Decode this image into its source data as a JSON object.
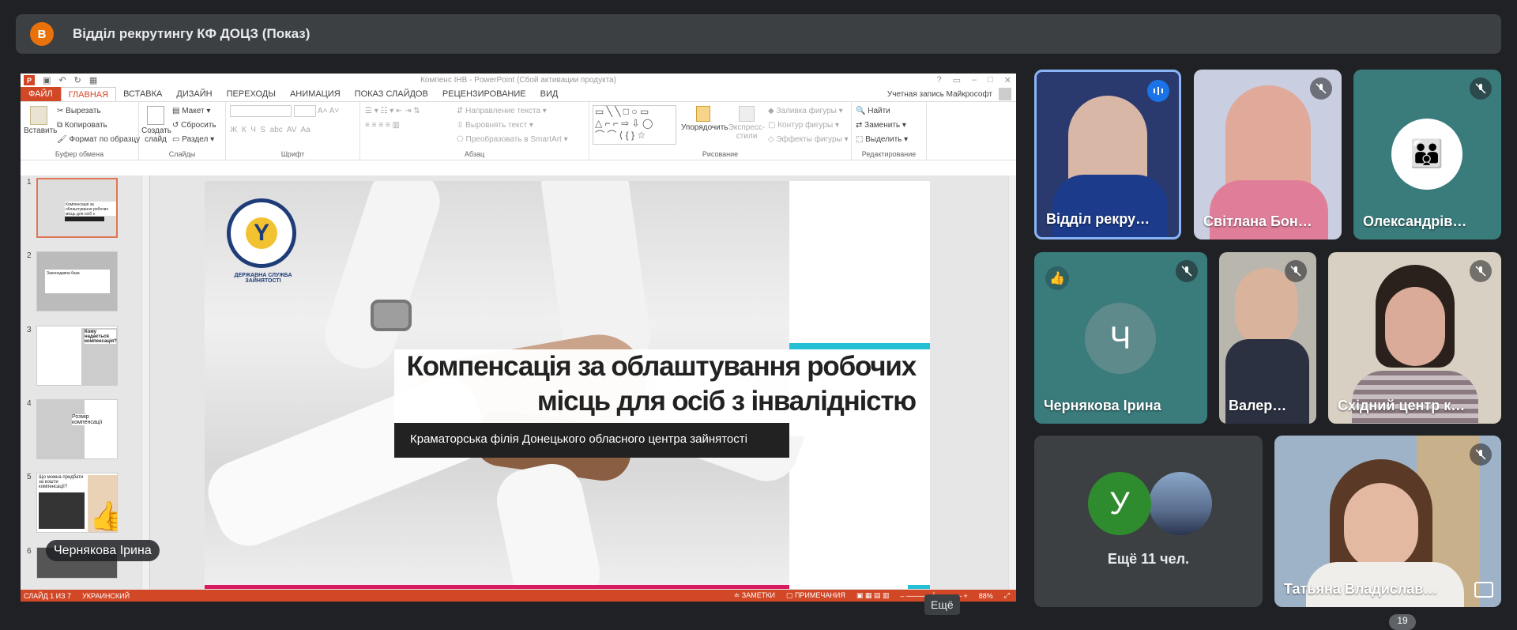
{
  "meeting": {
    "avatar_letter": "В",
    "title": "Відділ рекрутингу КФ ДОЦЗ (Показ)"
  },
  "ppt": {
    "window_title": "Компенс ІНВ - PowerPoint (Сбой активации продукта)",
    "app_badge": "P",
    "tabs": [
      "ФАЙЛ",
      "ГЛАВНАЯ",
      "ВСТАВКА",
      "ДИЗАЙН",
      "ПЕРЕХОДЫ",
      "АНИМАЦИЯ",
      "ПОКАЗ СЛАЙДОВ",
      "РЕЦЕНЗИРОВАНИЕ",
      "ВИД"
    ],
    "active_tab": "ГЛАВНАЯ",
    "account": "Учетная запись Майкрософт",
    "ribbon": {
      "clipboard": {
        "paste": "Вставить",
        "cut": "Вырезать",
        "copy": "Копировать",
        "format": "Формат по образцу",
        "label": "Буфер обмена"
      },
      "slides": {
        "new_slide": "Создать слайд",
        "layout": "Макет",
        "reset": "Сбросить",
        "section": "Раздел",
        "label": "Слайды"
      },
      "font": {
        "label": "Шрифт",
        "styles": [
          "Ж",
          "К",
          "Ч",
          "S",
          "abc",
          "AV",
          "Aa"
        ]
      },
      "paragraph": {
        "direction": "Направление текста",
        "align": "Выровнять текст",
        "smartart": "Преобразовать в SmartArt",
        "label": "Абзац"
      },
      "drawing": {
        "arrange": "Упорядочить",
        "quick_styles": "Экспресс-стили",
        "fill": "Заливка фигуры",
        "outline": "Контур фигуры",
        "effects": "Эффекты фигуры",
        "label": "Рисование"
      },
      "editing": {
        "find": "Найти",
        "replace": "Заменить",
        "select": "Выделить",
        "label": "Редактирование"
      }
    },
    "thumbnails": [
      {
        "num": "1",
        "text": "Компенсація за облаштування робочих місць для осіб з інвалідністю"
      },
      {
        "num": "2",
        "text": "Законодавча база"
      },
      {
        "num": "3",
        "text": "Кому надається компенсація?"
      },
      {
        "num": "4",
        "text": "Розмір компенсації"
      },
      {
        "num": "5",
        "text": "Що можна придбати за кошти компенсації?"
      },
      {
        "num": "6",
        "text": ""
      }
    ],
    "slide": {
      "title_line1": "Компенсація за облаштування робочих",
      "title_line2": "місць для осіб з інвалідністю",
      "subtitle": "Краматорська філія Донецького обласного центра зайнятості",
      "logo_text": "ДЕРЖАВНА СЛУЖБА ЗАЙНЯТОСТІ",
      "logo_symbol": "Y"
    },
    "status": {
      "slide": "СЛАЙД 1 ИЗ 7",
      "language": "УКРАИНСКИЙ",
      "notes": "ЗАМЕТКИ",
      "comments": "ПРИМЕЧАНИЯ",
      "zoom": "88%"
    }
  },
  "presenter_chip": "Чернякова Ірина",
  "participants": [
    {
      "name": "Відділ рекру…",
      "state": "speaking"
    },
    {
      "name": "Світлана Бон…",
      "state": "muted"
    },
    {
      "name": "Олександрів…",
      "state": "muted"
    },
    {
      "name": "Чернякова Ірина",
      "state": "muted",
      "initial": "Ч",
      "reaction": "👍"
    },
    {
      "name": "Валер…",
      "state": "muted"
    },
    {
      "name": "Східний центр к…",
      "state": "muted"
    },
    {
      "name": "Татьяна Владислав…",
      "state": "muted"
    }
  ],
  "others": {
    "initial": "У",
    "label": "Ещё 11 чел."
  },
  "tooltip": "Ещё",
  "people_count": "19",
  "colors": {
    "background": "#202124",
    "tile": "#3c4043",
    "ppt_accent": "#d24726",
    "speaking": "#8ab4f8",
    "teal_tile": "#3a7b7c"
  }
}
